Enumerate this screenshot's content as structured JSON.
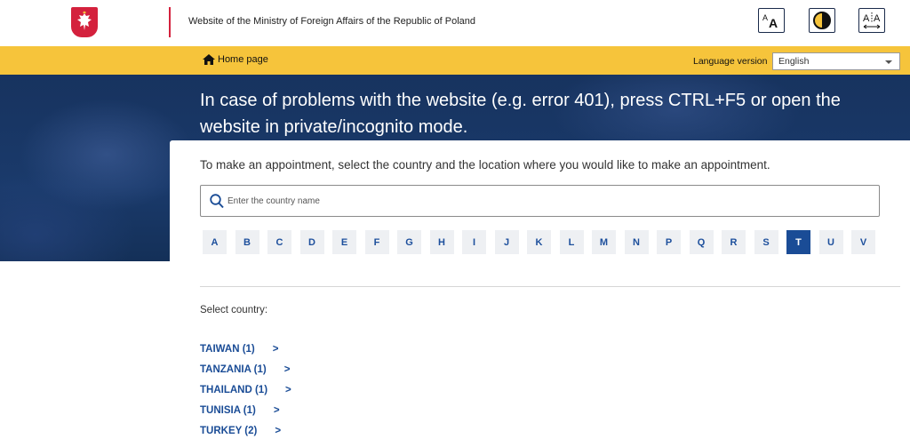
{
  "header": {
    "site_title": "Website of the Ministry of Foreign Affairs of the Republic of Poland",
    "accessibility": [
      {
        "name": "font-size-icon",
        "label": "AA"
      },
      {
        "name": "contrast-icon",
        "label": ""
      },
      {
        "name": "letter-spacing-icon",
        "label": "AA"
      }
    ]
  },
  "navbar": {
    "home_label": "Home page",
    "language_label": "Language version",
    "language_selected": "English"
  },
  "hero": {
    "message": "In case of problems with the website (e.g. error 401), press CTRL+F5 or open the website in private/incognito mode."
  },
  "main": {
    "instruction": "To make an appointment, select the country and the location where you would like to make an appointment.",
    "search_placeholder": "Enter the country name",
    "letters": [
      "A",
      "B",
      "C",
      "D",
      "E",
      "F",
      "G",
      "H",
      "I",
      "J",
      "K",
      "L",
      "M",
      "N",
      "P",
      "Q",
      "R",
      "S",
      "T",
      "U",
      "V"
    ],
    "active_letter": "T",
    "select_label": "Select country:",
    "countries": [
      {
        "label": "TAIWAN (1)",
        "chevron": ">"
      },
      {
        "label": "TANZANIA (1)",
        "chevron": ">"
      },
      {
        "label": "THAILAND (1)",
        "chevron": ">"
      },
      {
        "label": "TUNISIA (1)",
        "chevron": ">"
      },
      {
        "label": "TURKEY (2)",
        "chevron": ">"
      }
    ]
  },
  "colors": {
    "accent_yellow": "#f6c43b",
    "link_blue": "#1a4c96",
    "emblem_red": "#d4213d"
  }
}
